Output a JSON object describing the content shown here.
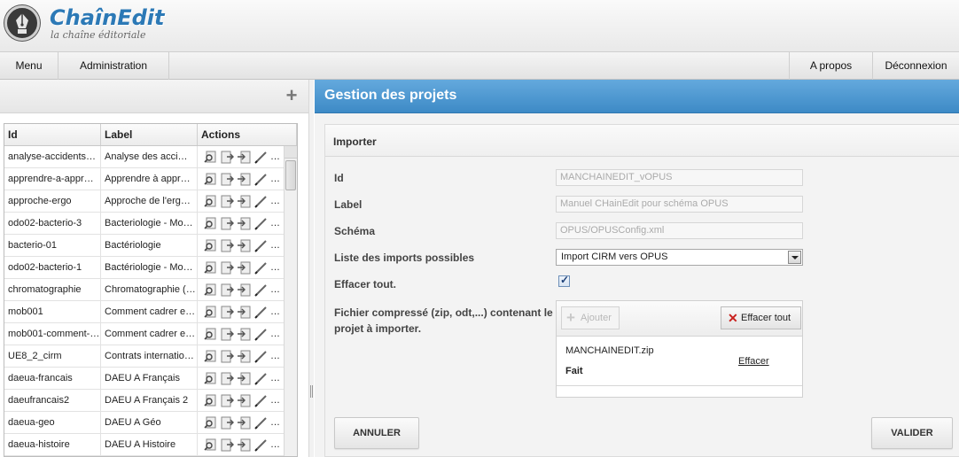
{
  "app": {
    "title": "ChaînEdit",
    "subtitle": "la chaîne éditoriale"
  },
  "menubar": {
    "menu": "Menu",
    "administration": "Administration",
    "apropos": "A propos",
    "deconnexion": "Déconnexion"
  },
  "leftpanel": {
    "add_icon": "plus-icon",
    "columns": [
      "Id",
      "Label",
      "Actions"
    ],
    "rows": [
      {
        "id": "analyse-accidents…",
        "label": "Analyse des acci…"
      },
      {
        "id": "apprendre-a-appr…",
        "label": "Apprendre à appr…"
      },
      {
        "id": "approche-ergo",
        "label": "Approche de l'erg…"
      },
      {
        "id": "odo02-bacterio-3",
        "label": "Bacteriologie - Mo…"
      },
      {
        "id": "bacterio-01",
        "label": "Bactériologie"
      },
      {
        "id": "odo02-bacterio-1",
        "label": "Bactériologie - Mo…"
      },
      {
        "id": "chromatographie",
        "label": "Chromatographie (…"
      },
      {
        "id": "mob001",
        "label": "Comment cadrer e…"
      },
      {
        "id": "mob001-comment-…",
        "label": "Comment cadrer e…"
      },
      {
        "id": "UE8_2_cirm",
        "label": "Contrats internatio…"
      },
      {
        "id": "daeua-francais",
        "label": "DAEU A Français"
      },
      {
        "id": "daeufrancais2",
        "label": "DAEU A Français 2"
      },
      {
        "id": "daeua-geo",
        "label": "DAEU A Géo"
      },
      {
        "id": "daeua-histoire",
        "label": "DAEU A Histoire"
      }
    ],
    "action_icons": [
      "search-icon",
      "export-icon",
      "import-icon",
      "edit-icon",
      "delete-icon"
    ]
  },
  "rightpanel": {
    "title": "Gestion des projets",
    "section": "Importer",
    "labels": {
      "id": "Id",
      "label": "Label",
      "schema": "Schéma",
      "imports": "Liste des imports possibles",
      "effacer": "Effacer tout.",
      "fichier_line1": "Fichier compressé (zip, odt,...) contenant le",
      "fichier_line2": "projet à importer."
    },
    "values": {
      "id": "MANCHAINEDIT_vOPUS",
      "label": "Manuel CHainEdit pour schéma OPUS",
      "schema": "OPUS/OPUSConfig.xml",
      "import_selected": "Import CIRM vers OPUS",
      "effacer_checked": true
    },
    "upload": {
      "ajouter": "Ajouter",
      "effacer_tout": "Effacer tout",
      "file_name": "MANCHAINEDIT.zip",
      "file_status": "Fait",
      "file_action": "Effacer"
    },
    "buttons": {
      "annuler": "ANNULER",
      "valider": "VALIDER"
    }
  },
  "colors": {
    "brand_blue": "#2c79b6",
    "title_bar": "#4a94cf",
    "delete_red": "#c9201d"
  }
}
